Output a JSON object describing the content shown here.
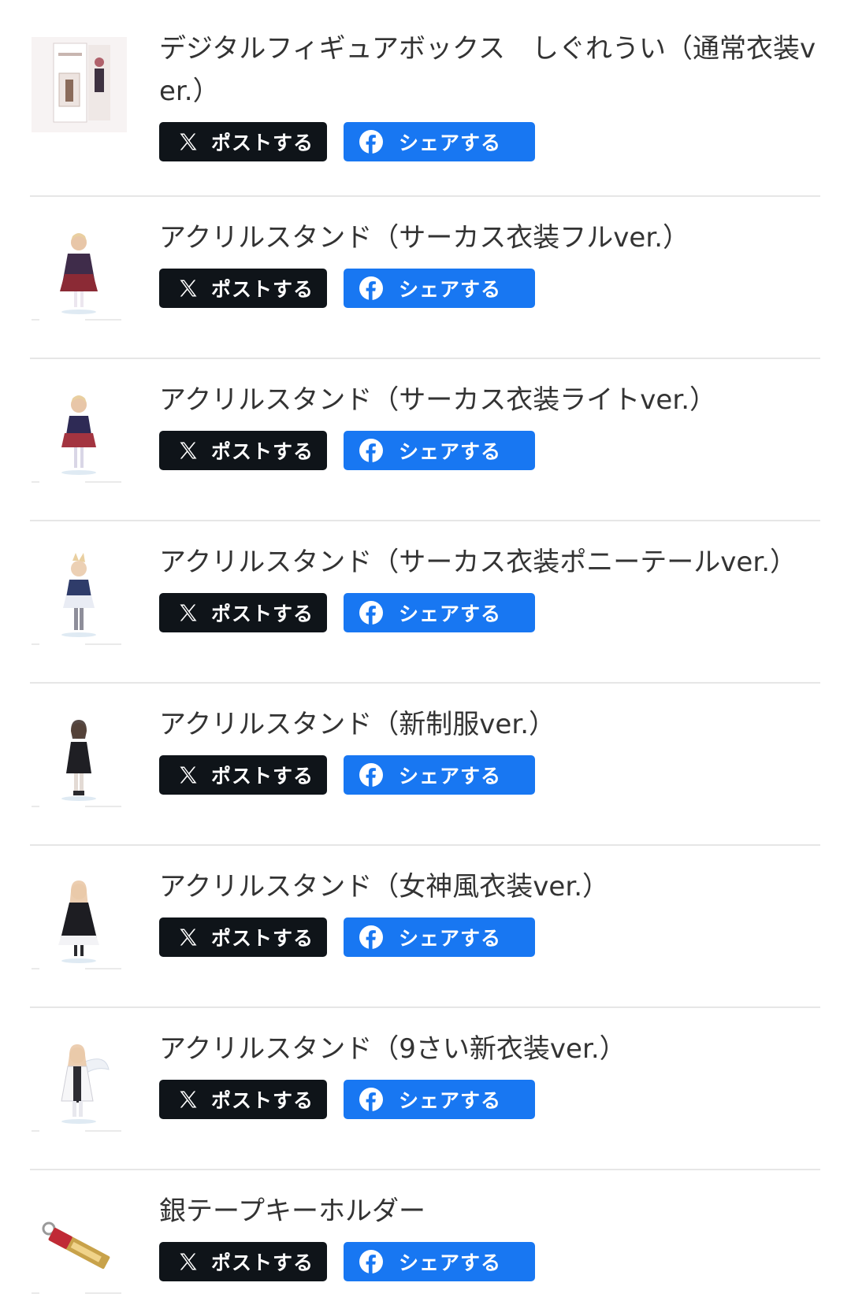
{
  "colors": {
    "x_button_bg": "#0f1419",
    "facebook_button_bg": "#1877f2",
    "button_text": "#ffffff",
    "title_text": "#333333",
    "divider": "#e6e6e6"
  },
  "buttons": {
    "x_label": "ポストする",
    "x_icon": "x-logo-icon",
    "facebook_label": "シェアする",
    "facebook_icon": "facebook-logo-icon"
  },
  "items": [
    {
      "title": "デジタルフィギュアボックス　しぐれうい（通常衣装ver.）",
      "thumbnail": "figure-box-thumbnail"
    },
    {
      "title": "アクリルスタンド（サーカス衣装フルver.）",
      "thumbnail": "acrylic-stand-thumbnail"
    },
    {
      "title": "アクリルスタンド（サーカス衣装ライトver.）",
      "thumbnail": "acrylic-stand-thumbnail"
    },
    {
      "title": "アクリルスタンド（サーカス衣装ポニーテールver.）",
      "thumbnail": "acrylic-stand-thumbnail"
    },
    {
      "title": "アクリルスタンド（新制服ver.）",
      "thumbnail": "acrylic-stand-thumbnail"
    },
    {
      "title": "アクリルスタンド（女神風衣装ver.）",
      "thumbnail": "acrylic-stand-thumbnail"
    },
    {
      "title": "アクリルスタンド（9さい新衣装ver.）",
      "thumbnail": "acrylic-stand-thumbnail"
    },
    {
      "title": "銀テープキーホルダー",
      "thumbnail": "keychain-thumbnail"
    }
  ]
}
